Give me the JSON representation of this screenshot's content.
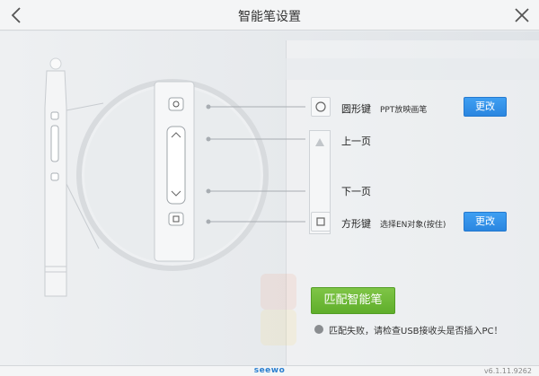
{
  "window": {
    "title": "智能笔设置"
  },
  "rows": {
    "circle_key": {
      "label": "圆形键",
      "desc": "PPT放映画笔",
      "button": "更改"
    },
    "page_up": {
      "label": "上一页"
    },
    "page_down": {
      "label": "下一页"
    },
    "square_key": {
      "label": "方形键",
      "desc": "选择EN对象(按住)",
      "button": "更改"
    }
  },
  "match_button": "匹配智能笔",
  "status": "匹配失败，请检查USB接收头是否插入PC！",
  "footer": {
    "brand": "seewo",
    "version": "v6.1.11.9262"
  },
  "colors": {
    "accent_blue": "#2a86e0",
    "accent_green": "#5fae2b",
    "status_gray": "#8a8d90"
  },
  "icons": {
    "back": "chevron-left-icon",
    "close": "close-icon",
    "circle": "circle-icon",
    "up": "triangle-up-icon",
    "down": "triangle-down-icon",
    "square": "square-icon"
  }
}
